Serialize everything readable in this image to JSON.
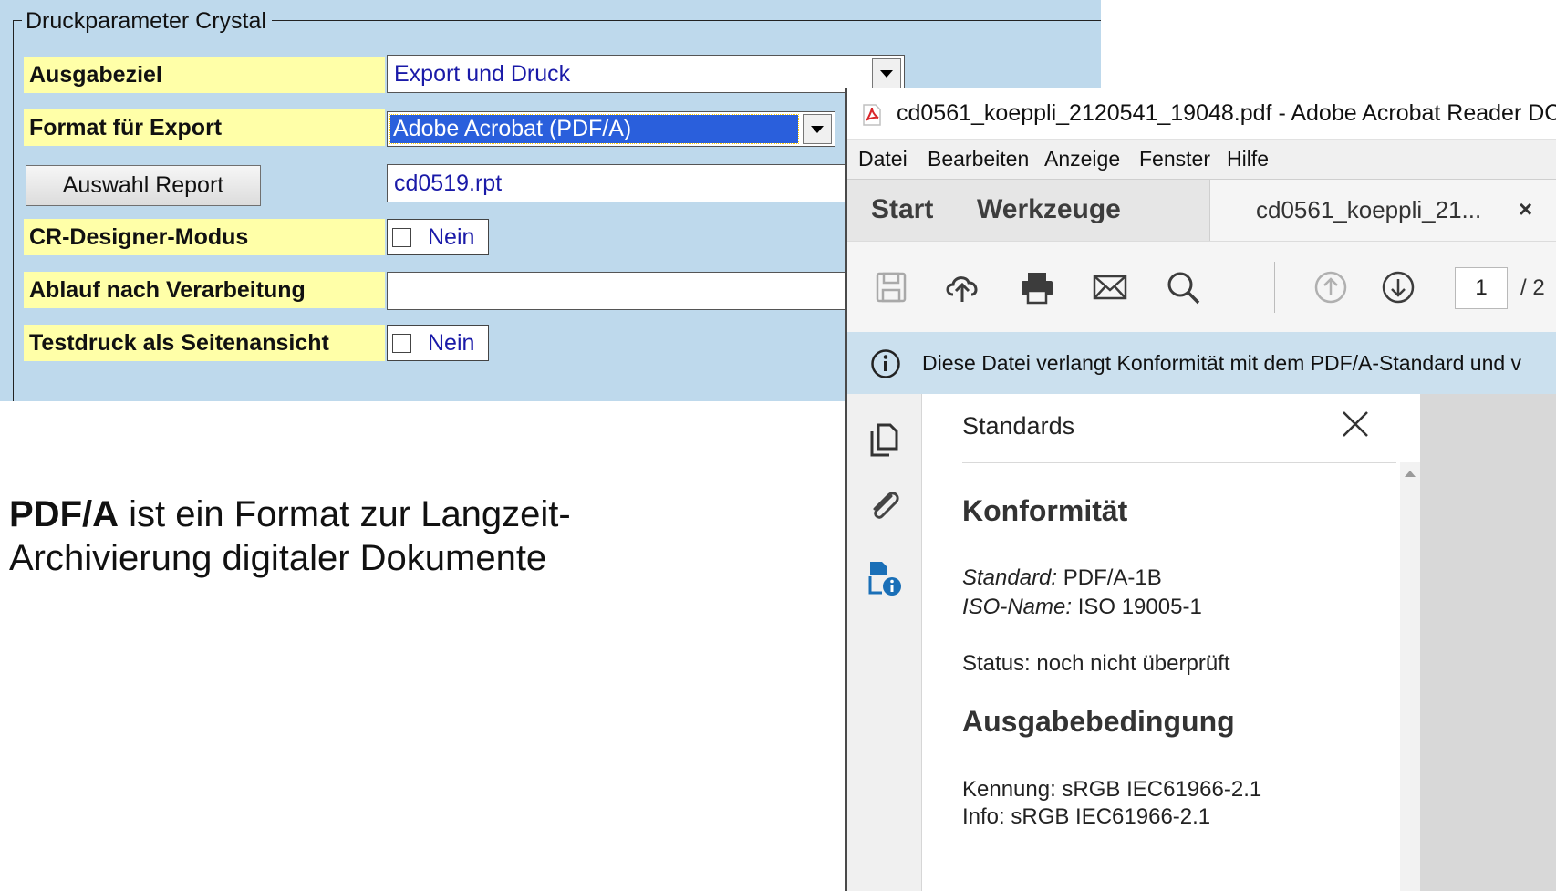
{
  "crystal_form": {
    "group_title": "Druckparameter Crystal",
    "ausgabeziel": {
      "label": "Ausgabeziel",
      "value": "Export und Druck"
    },
    "format_export": {
      "label": "Format für Export",
      "value": "Adobe Acrobat (PDF/A)"
    },
    "auswahl_report": {
      "button_label": "Auswahl Report",
      "value": "cd0519.rpt"
    },
    "cr_designer": {
      "label": "CR-Designer-Modus",
      "checkbox_text": "Nein"
    },
    "ablauf": {
      "label": "Ablauf nach Verarbeitung",
      "value": ""
    },
    "testdruck": {
      "label": "Testdruck als Seitenansicht",
      "checkbox_text": "Nein"
    }
  },
  "caption": {
    "bold": "PDF/A",
    "line1_rest": " ist ein Format zur Langzeit-",
    "line2": "Archivierung digitaler Dokumente"
  },
  "acrobat": {
    "window_title": "cd0561_koeppli_2120541_19048.pdf - Adobe Acrobat Reader DC",
    "menu": [
      "Datei",
      "Bearbeiten",
      "Anzeige",
      "Fenster",
      "Hilfe"
    ],
    "tabs": {
      "start": "Start",
      "werkzeuge": "Werkzeuge",
      "document": "cd0561_koeppli_21...",
      "close": "×"
    },
    "toolbar": {
      "icons": [
        "save-icon",
        "upload-cloud-icon",
        "print-icon",
        "email-icon",
        "search-icon",
        "page-up-icon",
        "page-down-icon"
      ],
      "page_current": "1",
      "page_total": "/ 2"
    },
    "info_message": "Diese Datei verlangt Konformität mit dem PDF/A-Standard und v",
    "standards_panel": {
      "title": "Standards",
      "conformance_heading": "Konformität",
      "standard_label": "Standard:",
      "standard_value": " PDF/A-1B",
      "iso_label": "ISO-Name:",
      "iso_value": " ISO 19005-1",
      "status": "Status: noch nicht überprüft",
      "output_heading": "Ausgabebedingung",
      "kennung": "Kennung: sRGB IEC61966-2.1",
      "info": "Info: sRGB IEC61966-2.1"
    },
    "colors": {
      "accent_blue": "#1a6fb7",
      "info_bar": "#cbe0ee",
      "pdf_red": "#d8262a"
    }
  }
}
